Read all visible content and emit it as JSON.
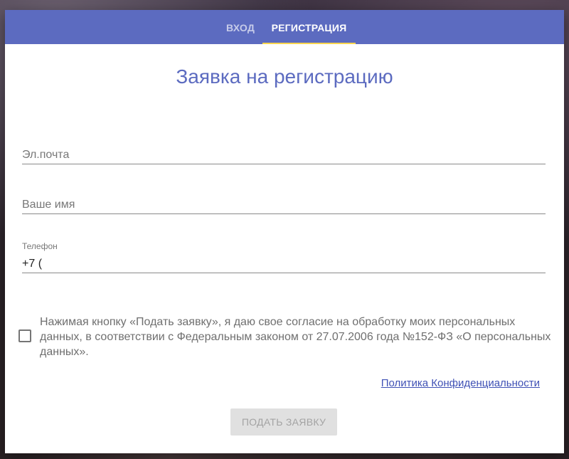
{
  "tabs": {
    "login_label": "Вход",
    "register_label": "Регистрация",
    "active": "register"
  },
  "form": {
    "title": "Заявка на регистрацию",
    "email": {
      "placeholder": "Эл.почта",
      "value": ""
    },
    "name": {
      "placeholder": "Ваше имя",
      "value": ""
    },
    "phone": {
      "label": "Телефон",
      "value": "+7 ("
    },
    "consent": {
      "checked": false,
      "text": "Нажимая кнопку «Подать заявку», я даю свое согласие на обработку моих персональных данных, в соответствии с Федеральным законом от 27.07.2006 года №152-ФЗ «О персональных данных»."
    },
    "privacy_link": "Политика Конфиденциальности",
    "submit_label": "Подать заявку",
    "submit_enabled": false
  },
  "colors": {
    "tabbar": "#5c6bc0",
    "tab_indicator": "#ffd54f",
    "title": "#5c6bc0",
    "link": "#3f51b5",
    "button_disabled_bg": "#e0e0e0",
    "button_disabled_text": "#a3a3a3"
  }
}
